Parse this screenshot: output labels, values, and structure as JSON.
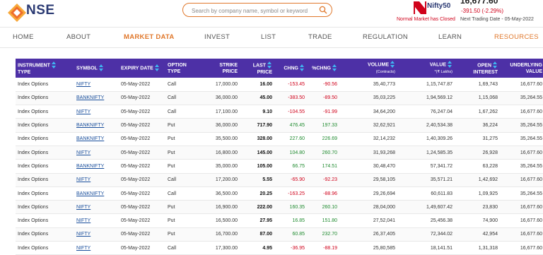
{
  "header": {
    "logo_text": "NSE",
    "search_placeholder": "Search by company name, symbol or keyword",
    "index_name": "Nifty50",
    "index_value": "16,677.60",
    "index_change": "-391.50 (-2.29%)",
    "market_status": "Normal Market has Closed",
    "next_trading": "Next Trading Date - 05-May-2022"
  },
  "nav": [
    "HOME",
    "ABOUT",
    "MARKET DATA",
    "INVEST",
    "LIST",
    "TRADE",
    "REGULATION",
    "LEARN",
    "RESOURCES"
  ],
  "table": {
    "headers": {
      "instrument": "INSTRUMENT",
      "instrument2": "TYPE",
      "symbol": "SYMBOL",
      "expiry": "EXPIRY DATE",
      "option": "OPTION",
      "option2": "TYPE",
      "strike": "STRIKE",
      "strike2": "PRICE",
      "last": "LAST",
      "last2": "PRICE",
      "chng": "CHNG",
      "pchng": "%CHNG",
      "volume": "VOLUME",
      "volume_sub": "(Contracts)",
      "value": "VALUE",
      "value_sub": "*(₹ Lakhs)",
      "oi": "OPEN",
      "oi2": "INTEREST",
      "underlying": "UNDERLYING",
      "underlying2": "VALUE"
    },
    "rows": [
      [
        "Index Options",
        "NIFTY",
        "05-May-2022",
        "Call",
        "17,000.00",
        "16.00",
        "-153.45",
        "-90.56",
        "35,40,773",
        "1,15,747.87",
        "1,69,743",
        "16,677.60"
      ],
      [
        "Index Options",
        "BANKNIFTY",
        "05-May-2022",
        "Call",
        "36,000.00",
        "45.00",
        "-383.50",
        "-89.50",
        "35,03,225",
        "1,94,569.12",
        "1,15,068",
        "35,264.55"
      ],
      [
        "Index Options",
        "NIFTY",
        "05-May-2022",
        "Call",
        "17,100.00",
        "9.10",
        "-104.55",
        "-91.99",
        "34,64,200",
        "76,247.04",
        "1,67,262",
        "16,677.60"
      ],
      [
        "Index Options",
        "BANKNIFTY",
        "05-May-2022",
        "Put",
        "36,000.00",
        "717.90",
        "476.45",
        "197.33",
        "32,62,921",
        "2,40,534.38",
        "36,224",
        "35,264.55"
      ],
      [
        "Index Options",
        "BANKNIFTY",
        "05-May-2022",
        "Put",
        "35,500.00",
        "328.00",
        "227.60",
        "226.69",
        "32,14,232",
        "1,40,309.26",
        "31,275",
        "35,264.55"
      ],
      [
        "Index Options",
        "NIFTY",
        "05-May-2022",
        "Put",
        "16,800.00",
        "145.00",
        "104.80",
        "260.70",
        "31,93,268",
        "1,24,585.35",
        "26,928",
        "16,677.60"
      ],
      [
        "Index Options",
        "BANKNIFTY",
        "05-May-2022",
        "Put",
        "35,000.00",
        "105.00",
        "66.75",
        "174.51",
        "30,48,470",
        "57,341.72",
        "63,228",
        "35,264.55"
      ],
      [
        "Index Options",
        "NIFTY",
        "05-May-2022",
        "Call",
        "17,200.00",
        "5.55",
        "-65.90",
        "-92.23",
        "29,58,105",
        "35,571.21",
        "1,42,692",
        "16,677.60"
      ],
      [
        "Index Options",
        "BANKNIFTY",
        "05-May-2022",
        "Call",
        "36,500.00",
        "20.25",
        "-163.25",
        "-88.96",
        "29,26,694",
        "60,611.83",
        "1,09,925",
        "35,264.55"
      ],
      [
        "Index Options",
        "NIFTY",
        "05-May-2022",
        "Put",
        "16,900.00",
        "222.00",
        "160.35",
        "260.10",
        "28,04,000",
        "1,49,607.42",
        "23,830",
        "16,677.60"
      ],
      [
        "Index Options",
        "NIFTY",
        "05-May-2022",
        "Put",
        "16,500.00",
        "27.95",
        "16.85",
        "151.80",
        "27,52,041",
        "25,456.38",
        "74,900",
        "16,677.60"
      ],
      [
        "Index Options",
        "NIFTY",
        "05-May-2022",
        "Put",
        "16,700.00",
        "87.00",
        "60.85",
        "232.70",
        "26,37,405",
        "72,344.02",
        "42,954",
        "16,677.60"
      ],
      [
        "Index Options",
        "NIFTY",
        "05-May-2022",
        "Call",
        "17,300.00",
        "4.95",
        "-36.95",
        "-88.19",
        "25,80,585",
        "18,141.51",
        "1,31,318",
        "16,677.60"
      ]
    ]
  },
  "colors": {
    "accent": "#e0782c",
    "header_bg": "#4d30a6",
    "negative": "#d0021b",
    "positive": "#1e8a2e",
    "link": "#1a4f9c"
  }
}
